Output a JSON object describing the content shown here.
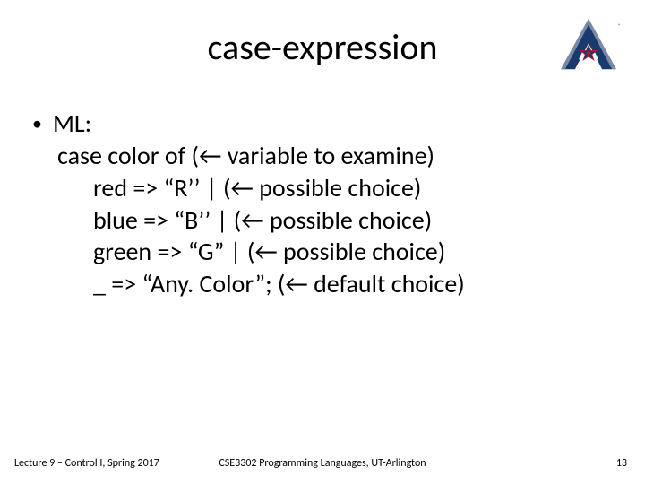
{
  "title": "case-expression",
  "logo": {
    "name": "uta-logo"
  },
  "content": {
    "bullet0": "ML:",
    "line1": "case color of  (← variable to examine)",
    "line2": "red => “R’’ |      (← possible choice)",
    "line3": "blue => “B’’ |    (← possible choice)",
    "line4": "green => “G” |  (← possible choice)",
    "line5": "_  => “Any. Color”; (← default choice)"
  },
  "footer": {
    "left": "Lecture 9 – Control I, Spring 2017",
    "center": "CSE3302 Programming Languages, UT-Arlington",
    "right": "13"
  }
}
